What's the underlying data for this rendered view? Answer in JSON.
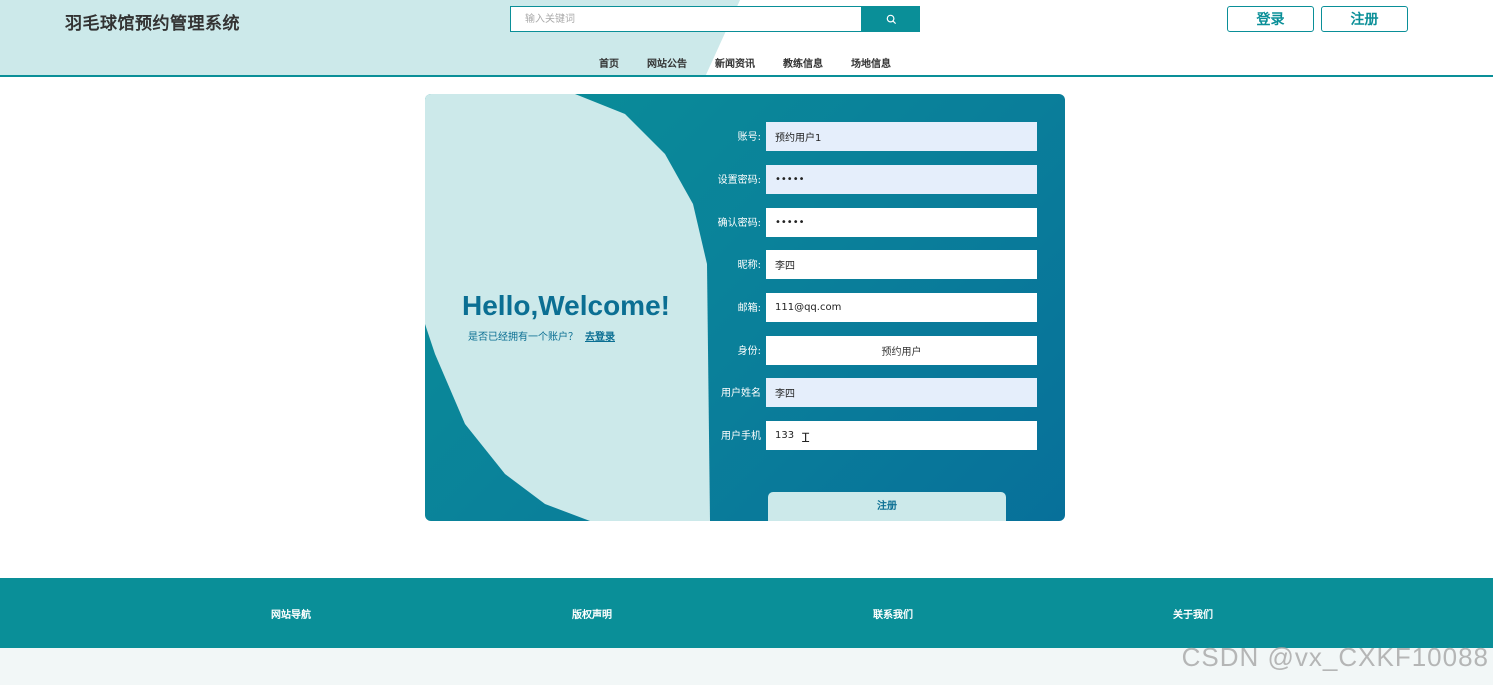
{
  "header": {
    "site_title": "羽毛球馆预约管理系统",
    "search_placeholder": "输入关键词",
    "login_label": "登录",
    "register_label": "注册",
    "nav": [
      "首页",
      "网站公告",
      "新闻资讯",
      "教练信息",
      "场地信息"
    ]
  },
  "welcome": {
    "title": "Hello,Welcome!",
    "prompt": "是否已经拥有一个账户？",
    "login_link": "去登录"
  },
  "form": {
    "account_label": "账号:",
    "account_value": "预约用户1",
    "password_label": "设置密码:",
    "password_value": "•••••",
    "confirm_label": "确认密码:",
    "confirm_value": "•••••",
    "nickname_label": "昵称:",
    "nickname_value": "李四",
    "email_label": "邮箱:",
    "email_value": "111@qq.com",
    "role_label": "身份:",
    "role_value": "预约用户",
    "realname_label": "用户姓名",
    "realname_value": "李四",
    "phone_label": "用户手机",
    "phone_value": "133",
    "submit_label": "注册"
  },
  "footer": {
    "items": [
      "网站导航",
      "版权声明",
      "联系我们",
      "关于我们"
    ]
  },
  "watermark": "CSDN @vx_CXKF10088",
  "colors": {
    "primary": "#0a8f98",
    "light": "#cce9ea",
    "dark_text": "#0b6f93"
  },
  "icons": {
    "search": "search-icon",
    "text_cursor": "text-cursor-icon"
  }
}
